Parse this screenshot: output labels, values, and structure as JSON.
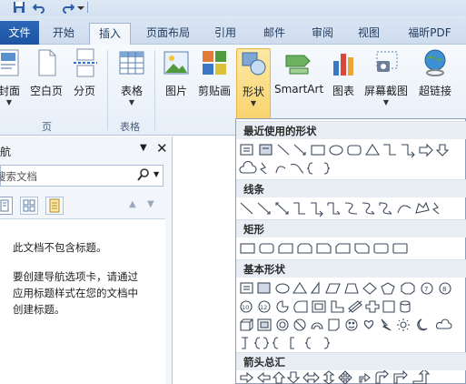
{
  "quick_access": {
    "icons": [
      "save-icon",
      "undo-icon",
      "redo-icon",
      "customize-icon"
    ]
  },
  "tabs": [
    {
      "label": "文件"
    },
    {
      "label": "开始"
    },
    {
      "label": "插入"
    },
    {
      "label": "页面布局"
    },
    {
      "label": "引用"
    },
    {
      "label": "邮件"
    },
    {
      "label": "审阅"
    },
    {
      "label": "视图"
    },
    {
      "label": "福昕PDF"
    }
  ],
  "active_tab": "插入",
  "ribbon": {
    "buttons": [
      {
        "label": "封面",
        "icon": "cover-page-icon"
      },
      {
        "label": "空白页",
        "icon": "blank-page-icon"
      },
      {
        "label": "分页",
        "icon": "page-break-icon"
      },
      {
        "label": "表格",
        "icon": "table-icon"
      },
      {
        "label": "图片",
        "icon": "picture-icon"
      },
      {
        "label": "剪贴画",
        "icon": "clip-art-icon"
      },
      {
        "label": "形状",
        "icon": "shapes-icon"
      },
      {
        "label": "SmartArt",
        "icon": "smartart-icon"
      },
      {
        "label": "图表",
        "icon": "chart-icon"
      },
      {
        "label": "屏幕截图",
        "icon": "screenshot-icon"
      },
      {
        "label": "超链接",
        "icon": "hyperlink-icon"
      }
    ],
    "groups": [
      {
        "label": "页"
      },
      {
        "label": "表格"
      }
    ],
    "selected_button": "形状"
  },
  "navigation": {
    "title": "导航",
    "search_placeholder": "搜索文档",
    "message_1": "此文档不包含标题。",
    "message_2_line1": "要创建导航选项卡，请通过",
    "message_2_line2": "应用标题样式在您的文档中",
    "message_2_line3": "创建标题。"
  },
  "shapes_gallery": {
    "sections": [
      {
        "title": "最近使用的形状"
      },
      {
        "title": "线条"
      },
      {
        "title": "矩形"
      },
      {
        "title": "基本形状"
      },
      {
        "title": "箭头总汇"
      }
    ]
  },
  "colors": {
    "accent": "#1d53a3",
    "selected": "#f9d36e",
    "ribbon_bg": "#e6eef8"
  }
}
